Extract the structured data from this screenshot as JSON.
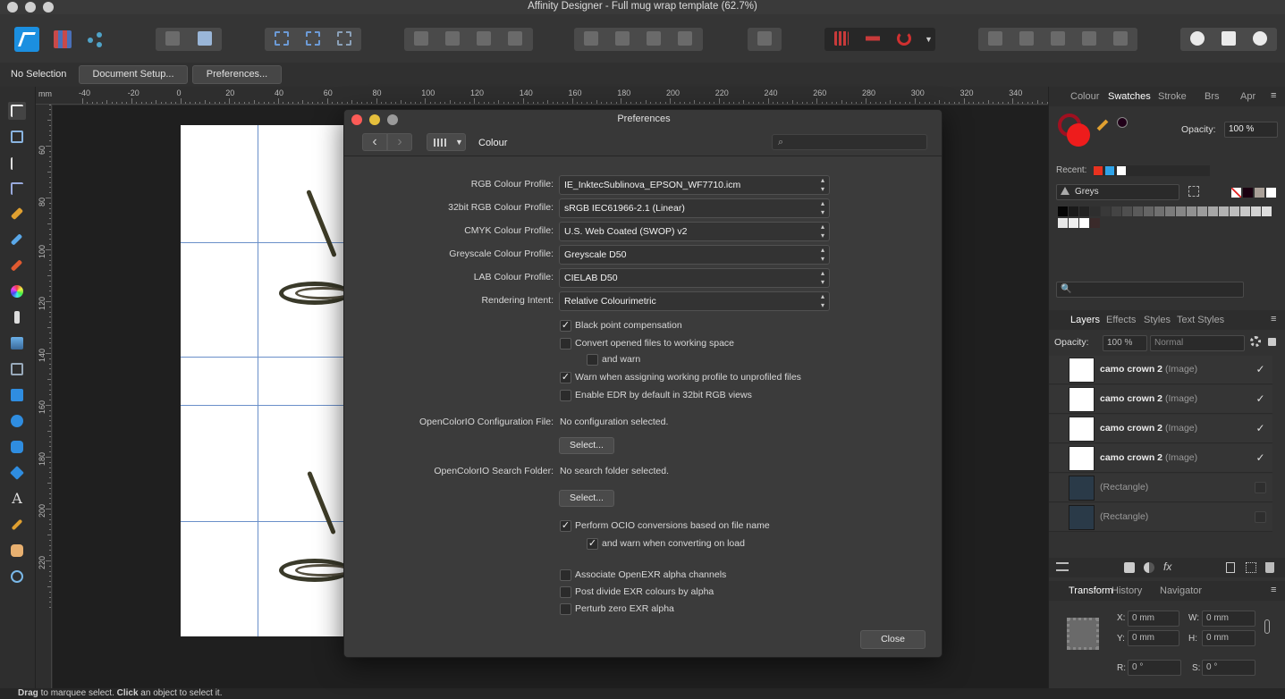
{
  "window": {
    "title": "Affinity Designer - Full mug wrap template (62.7%)"
  },
  "context_bar": {
    "selection": "No Selection",
    "document_setup": "Document Setup...",
    "preferences": "Preferences..."
  },
  "ruler": {
    "unit": "mm",
    "top_labels": [
      "-40",
      "-20",
      "0",
      "20",
      "40",
      "60",
      "80",
      "100",
      "120",
      "140",
      "160",
      "180",
      "200",
      "220",
      "240",
      "260",
      "280",
      "300",
      "320",
      "340"
    ],
    "left_labels": [
      "40",
      "60",
      "80",
      "100",
      "120",
      "140",
      "160",
      "180",
      "200",
      "220"
    ]
  },
  "preferences": {
    "title": "Preferences",
    "section": "Colour",
    "search_placeholder": "",
    "rows": [
      {
        "label": "RGB Colour Profile:",
        "value": "IE_InktecSublinova_EPSON_WF7710.icm"
      },
      {
        "label": "32bit RGB Colour Profile:",
        "value": "sRGB IEC61966-2.1 (Linear)"
      },
      {
        "label": "CMYK Colour Profile:",
        "value": "U.S. Web Coated (SWOP) v2"
      },
      {
        "label": "Greyscale Colour Profile:",
        "value": "Greyscale D50"
      },
      {
        "label": "LAB Colour Profile:",
        "value": "CIELAB D50"
      },
      {
        "label": "Rendering Intent:",
        "value": "Relative Colourimetric"
      }
    ],
    "checks1": [
      {
        "label": "Black point compensation",
        "checked": true
      },
      {
        "label": "Convert opened files to working space",
        "checked": false
      },
      {
        "label": "and warn",
        "checked": false
      },
      {
        "label": "Warn when assigning working profile to unprofiled files",
        "checked": true
      },
      {
        "label": "Enable EDR by default in 32bit RGB views",
        "checked": false
      }
    ],
    "ocio_config_label": "OpenColorIO Configuration File:",
    "ocio_config_value": "No configuration selected.",
    "ocio_folder_label": "OpenColorIO Search Folder:",
    "ocio_folder_value": "No search folder selected.",
    "select_label": "Select...",
    "checks2": [
      {
        "label": "Perform OCIO conversions based on file name",
        "checked": true
      },
      {
        "label": "and warn when converting on load",
        "checked": true
      }
    ],
    "checks3": [
      {
        "label": "Associate OpenEXR alpha channels",
        "checked": false
      },
      {
        "label": "Post divide EXR colours by alpha",
        "checked": false
      },
      {
        "label": "Perturb zero EXR alpha",
        "checked": false
      }
    ],
    "close_label": "Close"
  },
  "swatches_panel": {
    "tabs": [
      "Colour",
      "Swatches",
      "Stroke",
      "Brs",
      "Apr"
    ],
    "active_tab": "Swatches",
    "opacity_label": "Opacity:",
    "opacity_value": "100 %",
    "recent_label": "Recent:",
    "palette": "Greys",
    "recent_colors": [
      "#e8321f",
      "#2fa3e8",
      "#ffffff"
    ]
  },
  "layers_panel": {
    "tabs": [
      "Layers",
      "Effects",
      "Styles",
      "Text Styles"
    ],
    "active_tab": "Layers",
    "opacity_label": "Opacity:",
    "opacity_value": "100 %",
    "blend_mode": "Normal",
    "layers": [
      {
        "name": "camo crown 2",
        "kind": "(Image)",
        "visible": true
      },
      {
        "name": "camo crown 2",
        "kind": "(Image)",
        "visible": true
      },
      {
        "name": "camo crown 2",
        "kind": "(Image)",
        "visible": true
      },
      {
        "name": "camo crown 2",
        "kind": "(Image)",
        "visible": true
      },
      {
        "name": "",
        "kind": "(Rectangle)",
        "visible": false
      },
      {
        "name": "",
        "kind": "(Rectangle)",
        "visible": false
      }
    ]
  },
  "transform_panel": {
    "tabs": [
      "Transform",
      "History",
      "Navigator"
    ],
    "active_tab": "Transform",
    "x_label": "X:",
    "x_value": "0 mm",
    "y_label": "Y:",
    "y_value": "0 mm",
    "w_label": "W:",
    "w_value": "0 mm",
    "h_label": "H:",
    "h_value": "0 mm",
    "r_label": "R:",
    "r_value": "0 °",
    "s_label": "S:",
    "s_value": "0 °"
  },
  "status_bar": {
    "drag": "Drag",
    "drag_text": " to marquee select. ",
    "click": "Click",
    "click_text": " an object to select it."
  }
}
